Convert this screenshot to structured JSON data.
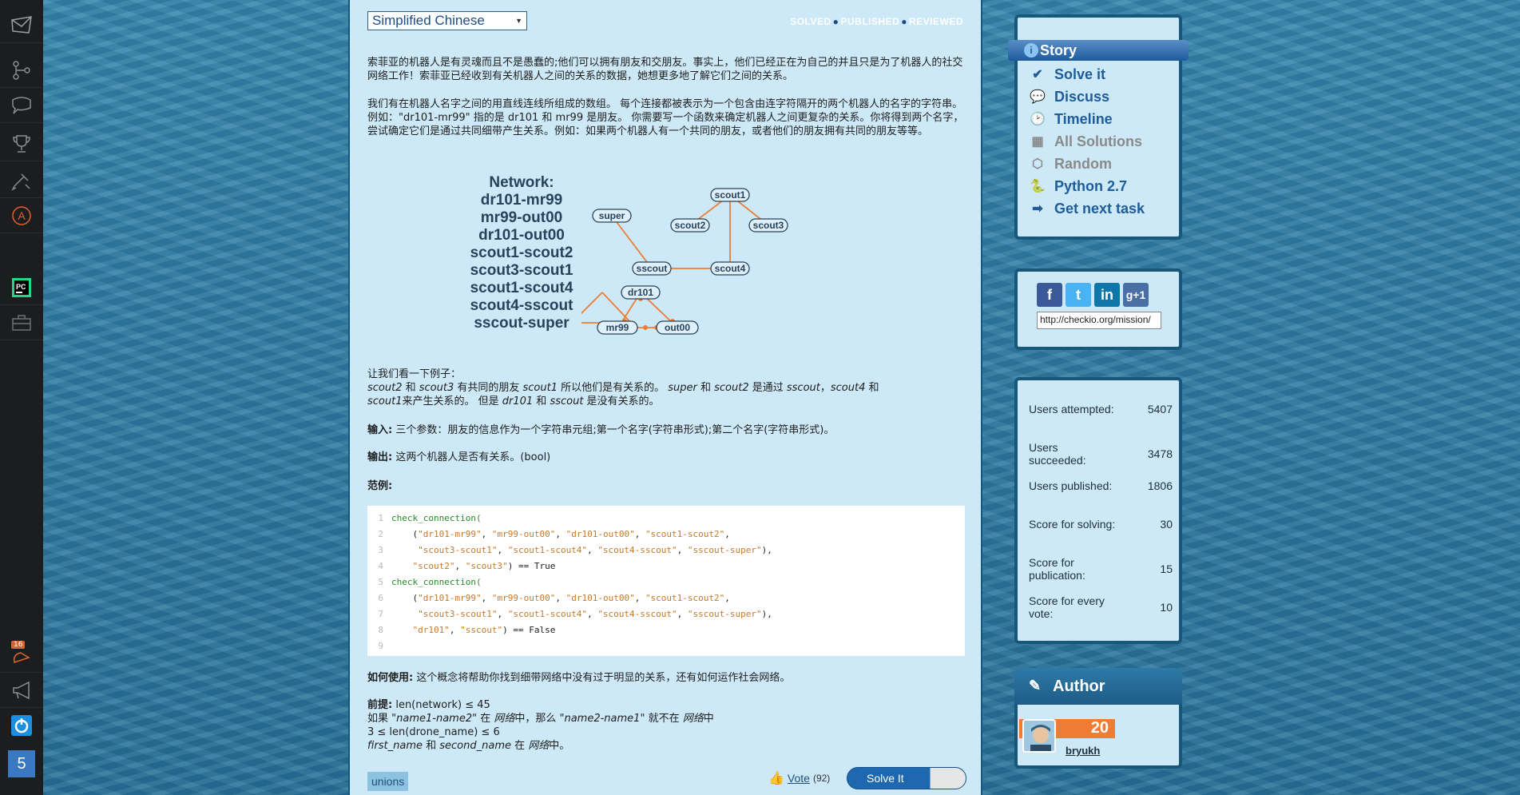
{
  "leftbar": {
    "badge": "16",
    "level": "5"
  },
  "header": {
    "language": "Simplified Chinese",
    "status": [
      "SOLVED",
      "PUBLISHED",
      "REVIEWED"
    ]
  },
  "content": {
    "p1": "索菲亚的机器人是有灵魂而且不是愚蠢的;他们可以拥有朋友和交朋友。事实上，他们已经正在为自己的并且只是为了机器人的社交网络工作！索菲亚已经收到有关机器人之间的关系的数据，她想更多地了解它们之间的关系。",
    "p2": "我们有在机器人名字之间的用直线连线所组成的数组。 每个连接都被表示为一个包含由连字符隔开的两个机器人的名字的字符串。 例如：\"dr101-mr99\" 指的是 dr101 和 mr99 是朋友。 你需要写一个函数来确定机器人之间更复杂的关系。你将得到两个名字，尝试确定它们是通过共同细带产生关系。例如：如果两个机器人有一个共同的朋友，或者他们的朋友拥有共同的朋友等等。",
    "network_title": "Network:",
    "network": [
      "dr101-mr99",
      "mr99-out00",
      "dr101-out00",
      "scout1-scout2",
      "scout3-scout1",
      "scout1-scout4",
      "scout4-sscout",
      "sscout-super"
    ],
    "nodes": [
      "scout1",
      "super",
      "scout2",
      "scout3",
      "sscout",
      "scout4",
      "dr101",
      "mr99",
      "out00"
    ],
    "ex_intro": "让我们看一下例子：",
    "ex1_a": "scout2",
    "ex1_b": " 和 ",
    "ex1_c": "scout3",
    "ex1_d": " 有共同的朋友 ",
    "ex1_e": "scout1",
    "ex1_f": " 所以他们是有关系的。 ",
    "ex1_g": "super",
    "ex1_h": " 和 ",
    "ex1_i": "scout2",
    "ex1_j": " 是通过 ",
    "ex1_k": "sscout",
    "ex1_l": "，",
    "ex1_m": "scout4",
    "ex1_n": " 和",
    "ex2_a": "scout1",
    "ex2_b": "来产生关系的。 但是 ",
    "ex2_c": "dr101",
    "ex2_d": " 和 ",
    "ex2_e": "sscout",
    "ex2_f": " 是没有关系的。",
    "input_label": "输入:",
    "input_text": " 三个参数：朋友的信息作为一个字符串元组;第一个名字(字符串形式);第二个名字(字符串形式)。",
    "output_label": "输出:",
    "output_text": " 这两个机器人是否有关系。(bool)",
    "example_label": "范例:",
    "usage_label": "如何使用:",
    "usage_text": " 这个概念将帮助你找到细带网络中没有过于明显的关系，还有如何运作社会网络。",
    "pre_label": "前提:",
    "pre_1": " len(network) ≤ 45",
    "pre_2a": "如果 ",
    "pre_2b": "\"name1-name2\"",
    "pre_2c": " 在 ",
    "pre_2d": "网络",
    "pre_2e": "中，那么 ",
    "pre_2f": "\"name2-name1\"",
    "pre_2g": " 就不在 ",
    "pre_2h": "网络",
    "pre_2i": "中",
    "pre_3": "3 ≤ len(drone_name) ≤ 6",
    "pre_4a": "first_name",
    "pre_4b": " 和 ",
    "pre_4c": "second_name",
    "pre_4d": " 在 ",
    "pre_4e": "网络",
    "pre_4f": "中。"
  },
  "code": {
    "line_numbers": [
      "1",
      "2",
      "3",
      "4",
      "5",
      "6",
      "7",
      "8",
      "9"
    ],
    "fn": "check_connection(",
    "l2": [
      "\"dr101-mr99\"",
      "\"mr99-out00\"",
      "\"dr101-out00\"",
      "\"scout1-scout2\""
    ],
    "l3": [
      "\"scout3-scout1\"",
      "\"scout1-scout4\"",
      "\"scout4-sscout\"",
      "\"sscout-super\""
    ],
    "l4": [
      "\"scout2\"",
      "\"scout3\""
    ],
    "l4_end": ") == True",
    "l8": [
      "\"dr101\"",
      "\"sscout\""
    ],
    "l8_end": ") == False"
  },
  "footer": {
    "tag": "unions",
    "vote_label": "Vote",
    "vote_count": "(92)",
    "solve_label": "Solve It"
  },
  "rightpanel": {
    "nav": [
      "Story",
      "Solve it",
      "Discuss",
      "Timeline",
      "All Solutions",
      "Random",
      "Python 2.7",
      "Get next task"
    ],
    "share_url": "http://checkio.org/mission/",
    "stats": [
      {
        "label": "Users attempted:",
        "value": "5407"
      },
      {
        "label": "Users succeeded:",
        "value": "3478"
      },
      {
        "label": "Users published:",
        "value": "1806"
      },
      {
        "label": "Score for solving:",
        "value": "30"
      },
      {
        "label": "Score for publication:",
        "value": "15"
      },
      {
        "label": "Score for every vote:",
        "value": "10"
      }
    ],
    "author_title": "Author",
    "author_level": "20",
    "author_name": "bryukh"
  },
  "colors": {
    "accent": "#1d5b9e",
    "edge": "#f07c33",
    "panel": "#cde9f7"
  }
}
